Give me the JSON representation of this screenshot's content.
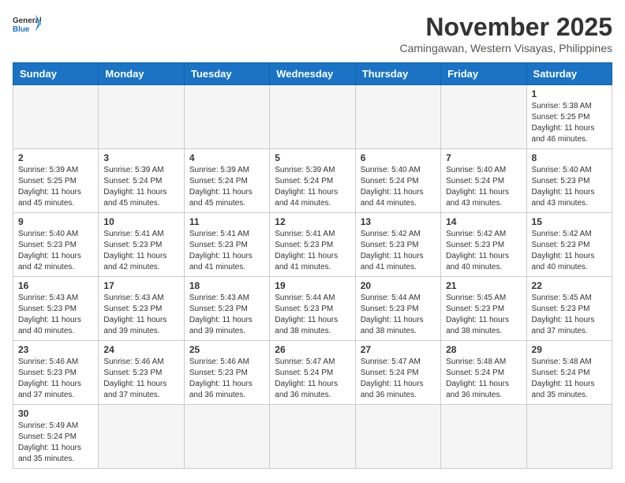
{
  "header": {
    "logo_general": "General",
    "logo_blue": "Blue",
    "month": "November 2025",
    "location": "Camingawan, Western Visayas, Philippines"
  },
  "days_of_week": [
    "Sunday",
    "Monday",
    "Tuesday",
    "Wednesday",
    "Thursday",
    "Friday",
    "Saturday"
  ],
  "weeks": [
    [
      {
        "day": "",
        "empty": true
      },
      {
        "day": "",
        "empty": true
      },
      {
        "day": "",
        "empty": true
      },
      {
        "day": "",
        "empty": true
      },
      {
        "day": "",
        "empty": true
      },
      {
        "day": "",
        "empty": true
      },
      {
        "day": "1",
        "info": "Sunrise: 5:38 AM\nSunset: 5:25 PM\nDaylight: 11 hours\nand 46 minutes."
      }
    ],
    [
      {
        "day": "2",
        "info": "Sunrise: 5:39 AM\nSunset: 5:25 PM\nDaylight: 11 hours\nand 45 minutes."
      },
      {
        "day": "3",
        "info": "Sunrise: 5:39 AM\nSunset: 5:24 PM\nDaylight: 11 hours\nand 45 minutes."
      },
      {
        "day": "4",
        "info": "Sunrise: 5:39 AM\nSunset: 5:24 PM\nDaylight: 11 hours\nand 45 minutes."
      },
      {
        "day": "5",
        "info": "Sunrise: 5:39 AM\nSunset: 5:24 PM\nDaylight: 11 hours\nand 44 minutes."
      },
      {
        "day": "6",
        "info": "Sunrise: 5:40 AM\nSunset: 5:24 PM\nDaylight: 11 hours\nand 44 minutes."
      },
      {
        "day": "7",
        "info": "Sunrise: 5:40 AM\nSunset: 5:24 PM\nDaylight: 11 hours\nand 43 minutes."
      },
      {
        "day": "8",
        "info": "Sunrise: 5:40 AM\nSunset: 5:23 PM\nDaylight: 11 hours\nand 43 minutes."
      }
    ],
    [
      {
        "day": "9",
        "info": "Sunrise: 5:40 AM\nSunset: 5:23 PM\nDaylight: 11 hours\nand 42 minutes."
      },
      {
        "day": "10",
        "info": "Sunrise: 5:41 AM\nSunset: 5:23 PM\nDaylight: 11 hours\nand 42 minutes."
      },
      {
        "day": "11",
        "info": "Sunrise: 5:41 AM\nSunset: 5:23 PM\nDaylight: 11 hours\nand 41 minutes."
      },
      {
        "day": "12",
        "info": "Sunrise: 5:41 AM\nSunset: 5:23 PM\nDaylight: 11 hours\nand 41 minutes."
      },
      {
        "day": "13",
        "info": "Sunrise: 5:42 AM\nSunset: 5:23 PM\nDaylight: 11 hours\nand 41 minutes."
      },
      {
        "day": "14",
        "info": "Sunrise: 5:42 AM\nSunset: 5:23 PM\nDaylight: 11 hours\nand 40 minutes."
      },
      {
        "day": "15",
        "info": "Sunrise: 5:42 AM\nSunset: 5:23 PM\nDaylight: 11 hours\nand 40 minutes."
      }
    ],
    [
      {
        "day": "16",
        "info": "Sunrise: 5:43 AM\nSunset: 5:23 PM\nDaylight: 11 hours\nand 40 minutes."
      },
      {
        "day": "17",
        "info": "Sunrise: 5:43 AM\nSunset: 5:23 PM\nDaylight: 11 hours\nand 39 minutes."
      },
      {
        "day": "18",
        "info": "Sunrise: 5:43 AM\nSunset: 5:23 PM\nDaylight: 11 hours\nand 39 minutes."
      },
      {
        "day": "19",
        "info": "Sunrise: 5:44 AM\nSunset: 5:23 PM\nDaylight: 11 hours\nand 38 minutes."
      },
      {
        "day": "20",
        "info": "Sunrise: 5:44 AM\nSunset: 5:23 PM\nDaylight: 11 hours\nand 38 minutes."
      },
      {
        "day": "21",
        "info": "Sunrise: 5:45 AM\nSunset: 5:23 PM\nDaylight: 11 hours\nand 38 minutes."
      },
      {
        "day": "22",
        "info": "Sunrise: 5:45 AM\nSunset: 5:23 PM\nDaylight: 11 hours\nand 37 minutes."
      }
    ],
    [
      {
        "day": "23",
        "info": "Sunrise: 5:46 AM\nSunset: 5:23 PM\nDaylight: 11 hours\nand 37 minutes."
      },
      {
        "day": "24",
        "info": "Sunrise: 5:46 AM\nSunset: 5:23 PM\nDaylight: 11 hours\nand 37 minutes."
      },
      {
        "day": "25",
        "info": "Sunrise: 5:46 AM\nSunset: 5:23 PM\nDaylight: 11 hours\nand 36 minutes."
      },
      {
        "day": "26",
        "info": "Sunrise: 5:47 AM\nSunset: 5:24 PM\nDaylight: 11 hours\nand 36 minutes."
      },
      {
        "day": "27",
        "info": "Sunrise: 5:47 AM\nSunset: 5:24 PM\nDaylight: 11 hours\nand 36 minutes."
      },
      {
        "day": "28",
        "info": "Sunrise: 5:48 AM\nSunset: 5:24 PM\nDaylight: 11 hours\nand 36 minutes."
      },
      {
        "day": "29",
        "info": "Sunrise: 5:48 AM\nSunset: 5:24 PM\nDaylight: 11 hours\nand 35 minutes."
      }
    ],
    [
      {
        "day": "30",
        "info": "Sunrise: 5:49 AM\nSunset: 5:24 PM\nDaylight: 11 hours\nand 35 minutes."
      },
      {
        "day": "",
        "empty": true
      },
      {
        "day": "",
        "empty": true
      },
      {
        "day": "",
        "empty": true
      },
      {
        "day": "",
        "empty": true
      },
      {
        "day": "",
        "empty": true
      },
      {
        "day": "",
        "empty": true
      }
    ]
  ]
}
